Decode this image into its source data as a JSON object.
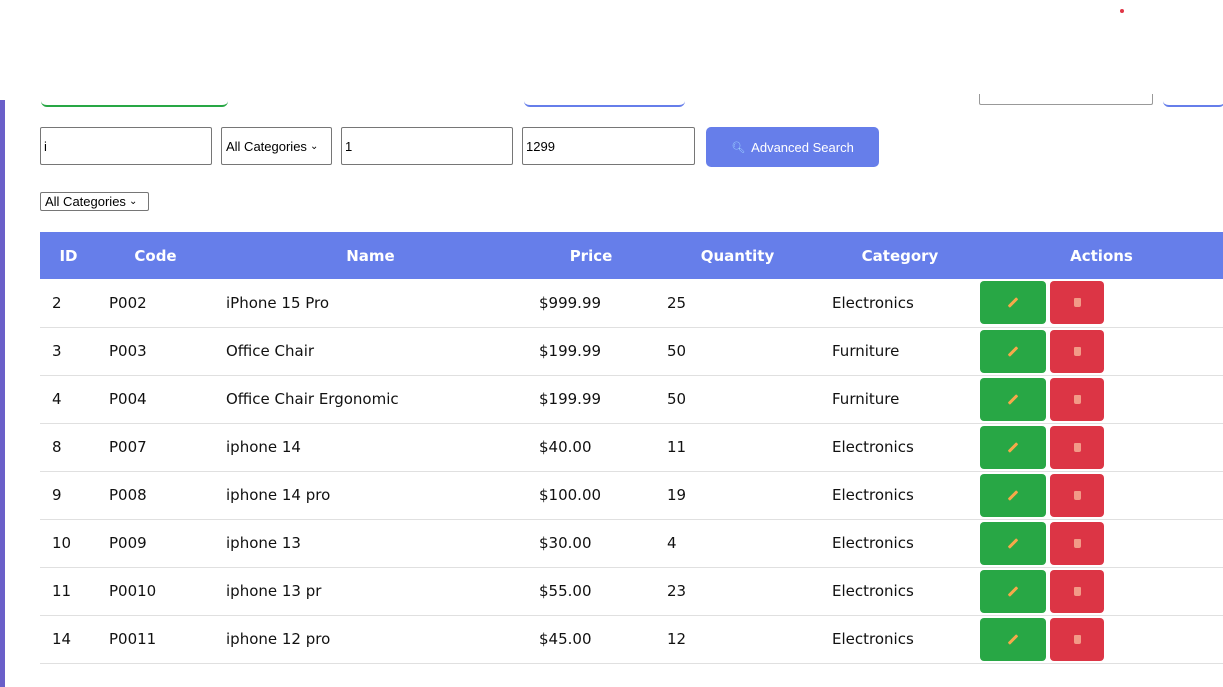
{
  "search": {
    "value": "i"
  },
  "category_select": {
    "value": "All Categories"
  },
  "min_price": {
    "value": "1"
  },
  "max_price": {
    "value": "1299"
  },
  "advanced_search": {
    "label": "Advanced Search",
    "icon": "magnifier-icon"
  },
  "filter_select": {
    "value": "All Categories"
  },
  "table": {
    "headers": [
      "ID",
      "Code",
      "Name",
      "Price",
      "Quantity",
      "Category",
      "Actions"
    ],
    "rows": [
      [
        "2",
        "P002",
        "iPhone 15 Pro",
        "$999.99",
        "25",
        "Electronics"
      ],
      [
        "3",
        "P003",
        "Office Chair",
        "$199.99",
        "50",
        "Furniture"
      ],
      [
        "4",
        "P004",
        "Office Chair Ergonomic",
        "$199.99",
        "50",
        "Furniture"
      ],
      [
        "8",
        "P007",
        "iphone 14",
        "$40.00",
        "11",
        "Electronics"
      ],
      [
        "9",
        "P008",
        "iphone 14 pro",
        "$100.00",
        "19",
        "Electronics"
      ],
      [
        "10",
        "P009",
        "iphone 13",
        "$30.00",
        "4",
        "Electronics"
      ],
      [
        "11",
        "P0010",
        "iphone 13 pr",
        "$55.00",
        "23",
        "Electronics"
      ],
      [
        "14",
        "P0011",
        "iphone 12 pro",
        "$45.00",
        "12",
        "Electronics"
      ]
    ]
  },
  "colors": {
    "header_bg": "#667eea",
    "edit": "#28a745",
    "delete": "#dc3545",
    "accent_bar": "#6a5fc9"
  },
  "icons": {
    "edit": "pencil-icon",
    "delete": "trash-icon"
  }
}
